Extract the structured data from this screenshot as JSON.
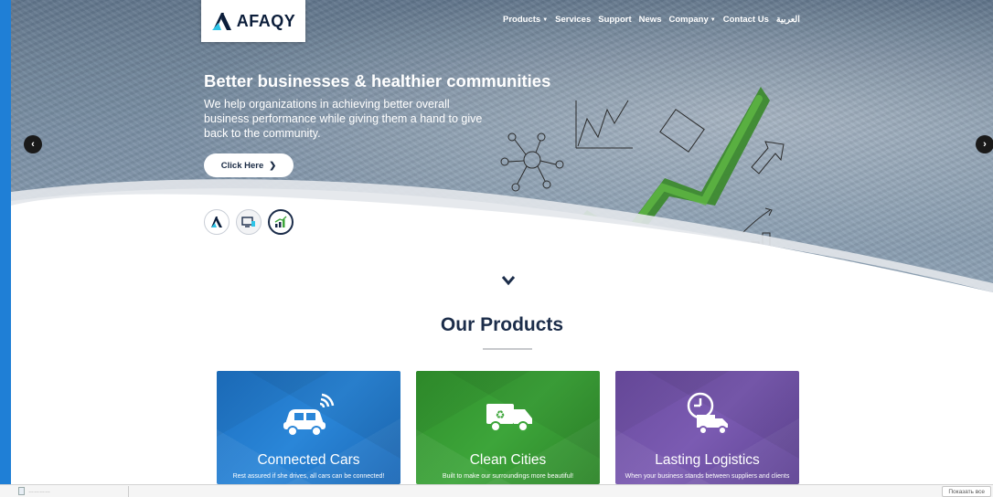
{
  "colors": {
    "frame": "#1f7fd6",
    "navy": "#1c2d4a",
    "connected": "#2a86d8",
    "clean": "#3da53a",
    "logistics": "#7b5bb2"
  },
  "brand": {
    "name": "AFAQY",
    "icon": "afaqy-logo-icon"
  },
  "nav": {
    "items": [
      {
        "label": "Products",
        "has_dropdown": true
      },
      {
        "label": "Services",
        "has_dropdown": false
      },
      {
        "label": "Support",
        "has_dropdown": false
      },
      {
        "label": "News",
        "has_dropdown": false
      },
      {
        "label": "Company",
        "has_dropdown": true
      },
      {
        "label": "Contact Us",
        "has_dropdown": false
      },
      {
        "label": "العربية",
        "has_dropdown": false
      }
    ]
  },
  "hero": {
    "title": "Better businesses & healthier communities",
    "description": "We help organizations in achieving better overall business performance while giving them a hand to give back to the community.",
    "cta_label": "Click Here",
    "slide_icons": [
      "afaqy-icon",
      "devices-icon",
      "growth-chart-icon"
    ]
  },
  "products": {
    "title": "Our Products",
    "cards": [
      {
        "title": "Connected Cars",
        "subtitle": "Rest assured if she drives, all cars can be connected!",
        "icon": "connected-car-icon"
      },
      {
        "title": "Clean Cities",
        "subtitle": "Built to make our surroundings more beautiful!",
        "icon": "garbage-truck-icon"
      },
      {
        "title": "Lasting Logistics",
        "subtitle": "When your business stands between suppliers and clients",
        "icon": "clock-truck-icon"
      }
    ]
  },
  "download_bar": {
    "file_label": "…………",
    "show_all": "Показать все"
  }
}
